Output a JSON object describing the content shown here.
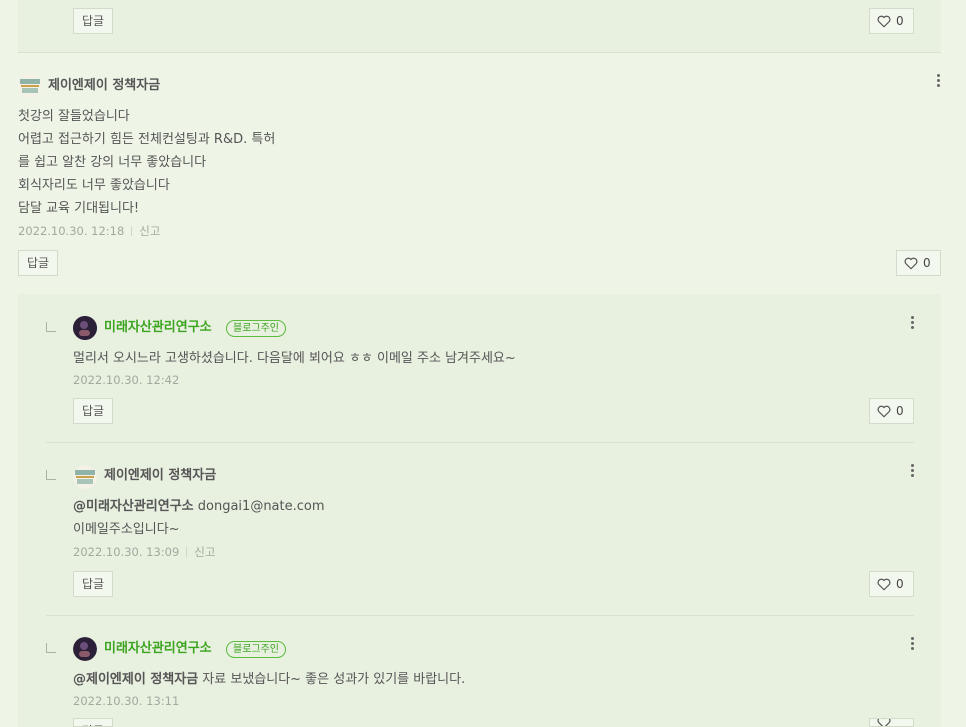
{
  "top_prev": {
    "reply_label": "답글",
    "like_count": "0"
  },
  "comment_main": {
    "author": "제이엔제이 정책자금",
    "lines": [
      "첫강의 잘들었습니다",
      "어렵고 접근하기 힘든 전체컨설팅과 R&D. 특허",
      "를 쉽고 알찬 강의 너무 좋았습니다",
      "회식자리도 너무 좋았습니다",
      "담달 교육 기대됩니다!"
    ],
    "date": "2022.10.30. 12:18",
    "report": "신고",
    "reply_label": "답글",
    "like_count": "0"
  },
  "reply1": {
    "author": "미래자산관리연구소",
    "badge": "블로그주인",
    "text": "멀리서 오시느라 고생하셨습니다. 다음달에 뵈어요 ㅎㅎ 이메일 주소 남겨주세요~",
    "date": "2022.10.30. 12:42",
    "reply_label": "답글",
    "like_count": "0"
  },
  "reply2": {
    "author": "제이엔제이 정책자금",
    "mention": "@미래자산관리연구소",
    "line1_rest": " dongai1@nate.com",
    "line2": "이메일주소입니다~",
    "date": "2022.10.30. 13:09",
    "report": "신고",
    "reply_label": "답글",
    "like_count": "0"
  },
  "reply3": {
    "author": "미래자산관리연구소",
    "badge": "블로그주인",
    "mention": "@제이엔제이 정책자금",
    "text_rest": " 자료 보냈습니다~ 좋은 성과가 있기를 바랍니다.",
    "date": "2022.10.30. 13:11",
    "reply_label": "답글"
  },
  "colors": {
    "page_bg": "#eef5e7",
    "reply_bg": "#e8f0e0",
    "owner_green": "#3ba41e",
    "meta_gray": "#a2a9a0"
  },
  "icons": [
    "heart-icon",
    "more-vertical-icon",
    "reply-indent-icon"
  ]
}
